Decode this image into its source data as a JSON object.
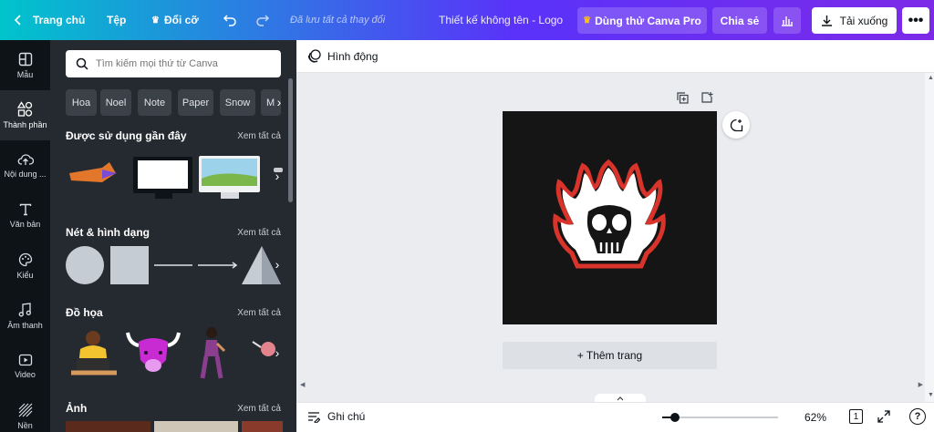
{
  "topbar": {
    "home": "Trang chủ",
    "file": "Tệp",
    "resize": "Đổi cỡ",
    "saved": "Đã lưu tất cả thay đổi",
    "doc_title": "Thiết kế không tên - Logo",
    "try_pro": "Dùng thử Canva Pro",
    "share": "Chia sẻ",
    "download": "Tải xuống"
  },
  "rail": {
    "templates": "Mẫu",
    "elements": "Thành phần",
    "uploads": "Nội dung ...",
    "text": "Văn bản",
    "styles": "Kiểu",
    "audio": "Âm thanh",
    "video": "Video",
    "background": "Nền"
  },
  "panel": {
    "search_placeholder": "Tìm kiếm mọi thứ từ Canva",
    "chips": [
      "Hoa",
      "Noel",
      "Note",
      "Paper",
      "Snow",
      "M"
    ],
    "sections": {
      "recent": "Được sử dụng gần đây",
      "lines_shapes": "Nét & hình dạng",
      "graphics": "Đồ họa",
      "photos": "Ảnh"
    },
    "see_all": "Xem tất cả"
  },
  "context_bar": {
    "animate": "Hình động"
  },
  "canvas": {
    "add_page": "+ Thêm trang"
  },
  "bottom": {
    "notes": "Ghi chú",
    "zoom": "62%",
    "page_num": "1",
    "help": "?"
  },
  "colors": {
    "accent": "#7d2ae8",
    "panel": "#252a31",
    "rail": "#0e1318"
  }
}
